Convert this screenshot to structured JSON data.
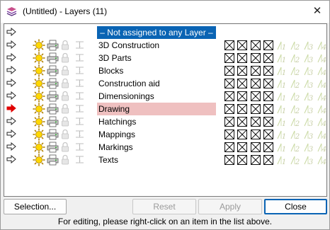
{
  "window": {
    "title": "(Untitled) - Layers (11)",
    "close_symbol": "✕"
  },
  "layers": {
    "header_label": "– Not assigned to any Layer –",
    "rows": [
      {
        "label": "3D Construction",
        "current": false
      },
      {
        "label": "3D Parts",
        "current": false
      },
      {
        "label": "Blocks",
        "current": false
      },
      {
        "label": "Construction aid",
        "current": false
      },
      {
        "label": "Dimensionings",
        "current": false
      },
      {
        "label": "Drawing",
        "current": true
      },
      {
        "label": "Hatchings",
        "current": false
      },
      {
        "label": "Mappings",
        "current": false
      },
      {
        "label": "Markings",
        "current": false
      },
      {
        "label": "Texts",
        "current": false
      }
    ],
    "digit_labels": [
      "1",
      "2",
      "3",
      "4"
    ]
  },
  "buttons": {
    "selection": "Selection...",
    "reset": "Reset",
    "apply": "Apply",
    "close": "Close"
  },
  "footer": {
    "hint": "For editing, please right-click on an item in the list above."
  },
  "colors": {
    "selected_bg": "#0a64b4",
    "current_bg": "#efc0c0",
    "current_arrow": "#e00000"
  }
}
